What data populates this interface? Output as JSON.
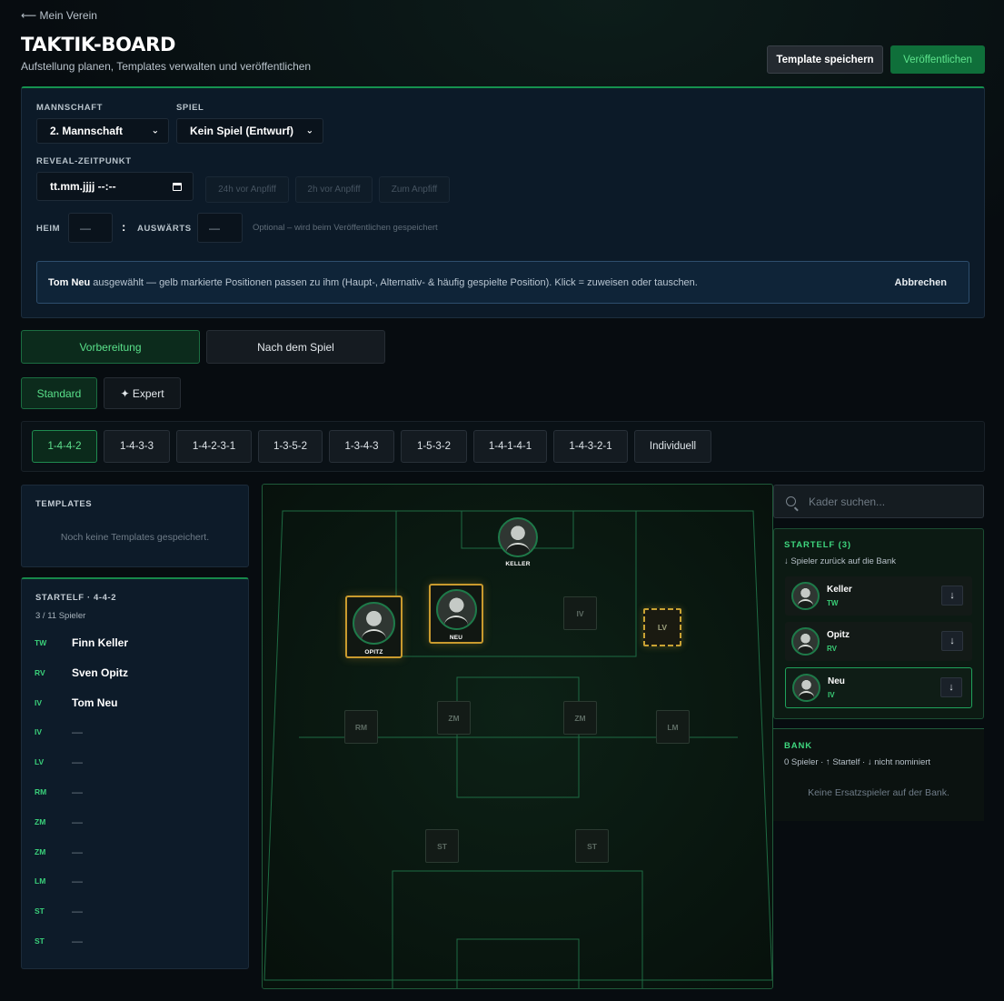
{
  "header": {
    "back_link": "⟵ Mein Verein",
    "title": "TAKTIK-BOARD",
    "subtitle": "Aufstellung planen, Templates verwalten und veröffentlichen",
    "save_template": "Template speichern",
    "publish": "Veröffentlichen"
  },
  "config": {
    "team_label": "MANNSCHAFT",
    "team_value": "2. Mannschaft",
    "match_label": "SPIEL",
    "match_value": "Kein Spiel (Entwurf)",
    "reveal_label": "REVEAL-ZEITPUNKT",
    "reveal_value": "tt.mm.jjjj --:--",
    "reveal_presets": [
      "24h vor Anpfiff",
      "2h vor Anpfiff",
      "Zum Anpfiff"
    ],
    "home_label": "HEIM",
    "home_value": "—",
    "away_label": "AUSWÄRTS",
    "away_value": "—",
    "separator": ":",
    "score_hint": "Optional – wird beim Veröffentlichen gespeichert"
  },
  "selection_hint": {
    "player": "Tom Neu",
    "text": " ausgewählt — gelb markierte Positionen passen zu ihm (Haupt-, Alternativ- & häufig gespielte Position). Klick = zuweisen oder tauschen.",
    "cancel": "Abbrechen"
  },
  "phase_tabs": [
    "Vorbereitung",
    "Nach dem Spiel"
  ],
  "mode_tabs": [
    "Standard",
    "✦ Expert"
  ],
  "formations": [
    "1-4-4-2",
    "1-4-3-3",
    "1-4-2-3-1",
    "1-3-5-2",
    "1-3-4-3",
    "1-5-3-2",
    "1-4-1-4-1",
    "1-4-3-2-1",
    "Individuell"
  ],
  "active_formation": "1-4-4-2",
  "templates": {
    "title": "TEMPLATES",
    "empty": "Noch keine Templates gespeichert."
  },
  "lineup": {
    "title": "STARTELF · 4-4-2",
    "count": "3 / 11 Spieler",
    "rows": [
      {
        "pos": "TW",
        "name": "Finn Keller"
      },
      {
        "pos": "RV",
        "name": "Sven Opitz"
      },
      {
        "pos": "IV",
        "name": "Tom Neu"
      },
      {
        "pos": "IV",
        "name": "—"
      },
      {
        "pos": "LV",
        "name": "—"
      },
      {
        "pos": "RM",
        "name": "—"
      },
      {
        "pos": "ZM",
        "name": "—"
      },
      {
        "pos": "ZM",
        "name": "—"
      },
      {
        "pos": "LM",
        "name": "—"
      },
      {
        "pos": "ST",
        "name": "—"
      },
      {
        "pos": "ST",
        "name": "—"
      }
    ]
  },
  "pitch": {
    "players": [
      {
        "id": "keller",
        "label": "KELLER"
      },
      {
        "id": "opitz",
        "label": "OPITZ"
      },
      {
        "id": "neu",
        "label": "NEU"
      }
    ],
    "slots": [
      "IV",
      "LV",
      "RM",
      "ZM",
      "ZM",
      "LM",
      "ST",
      "ST"
    ]
  },
  "squad": {
    "search_placeholder": "Kader suchen...",
    "starters_title": "STARTELF (3)",
    "starters_note": "↓ Spieler zurück auf die Bank",
    "starters": [
      {
        "name": "Keller",
        "pos": "TW"
      },
      {
        "name": "Opitz",
        "pos": "RV"
      },
      {
        "name": "Neu",
        "pos": "IV"
      }
    ],
    "down_icon": "↓",
    "bench_title": "BANK",
    "bench_note": "0 Spieler · ↑ Startelf · ↓ nicht nominiert",
    "bench_empty": "Keine Ersatzspieler auf der Bank."
  },
  "colors": {
    "accent_green": "#3ed67e",
    "highlight_gold": "#c99a2e",
    "background": "#070c10"
  }
}
